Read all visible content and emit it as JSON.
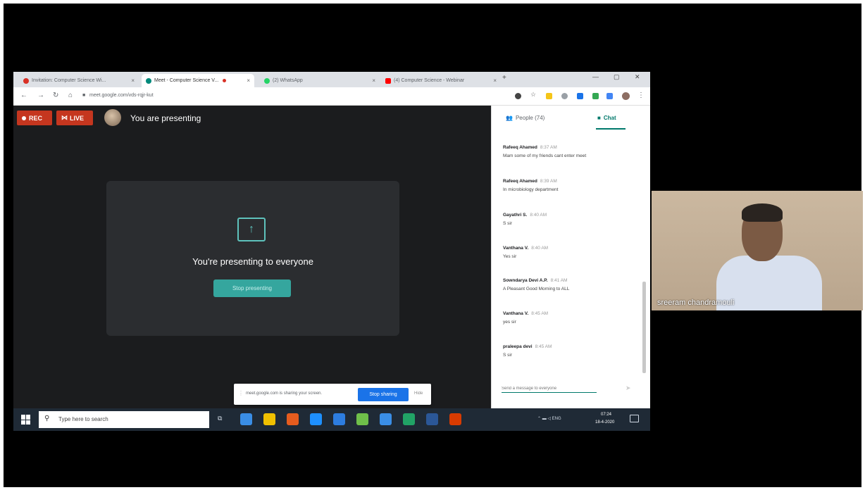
{
  "browser": {
    "tabs": [
      {
        "label": "Invitation: Computer Science Wi...",
        "favicon_color": "#d93025",
        "active": false
      },
      {
        "label": "Meet - Computer Science V...",
        "favicon_color": "#00897b",
        "active": true
      },
      {
        "label": "(2) WhatsApp",
        "favicon_color": "#25d366",
        "active": false
      },
      {
        "label": "(4) Computer Science - Webinar",
        "favicon_color": "#ff0000",
        "active": false
      }
    ],
    "new_tab": "+",
    "url": "meet.google.com/vds-rqjr-kut"
  },
  "meet": {
    "rec_label": "REC",
    "live_label": "LIVE",
    "presenting_label": "You are presenting",
    "present_icon": "↑",
    "presenting_to_everyone": "You're presenting to everyone",
    "stop_presenting": "Stop presenting"
  },
  "share_banner": {
    "text": "meet.google.com is sharing your screen.",
    "stop_sharing": "Stop sharing",
    "hide": "Hide"
  },
  "panel": {
    "people_tab": "People (74)",
    "chat_tab": "Chat",
    "messages": [
      {
        "sender": "Rafeeq Ahamed",
        "time": "8:37 AM",
        "text": "Mam some of my friends cant enter meet"
      },
      {
        "sender": "Rafeeq Ahamed",
        "time": "8:39 AM",
        "text": "In microbiology department"
      },
      {
        "sender": "Gayathri S.",
        "time": "8:40 AM",
        "text": "S sir"
      },
      {
        "sender": "Vanthana V.",
        "time": "8:40 AM",
        "text": "Yes sir"
      },
      {
        "sender": "Sowndarya Devi A.P.",
        "time": "8:41 AM",
        "text": "A Pleasant Good Morning to ALL"
      },
      {
        "sender": "Vanthana V.",
        "time": "8:45 AM",
        "text": "yes sir"
      },
      {
        "sender": "praleepa devi",
        "time": "8:45 AM",
        "text": "S sir"
      }
    ],
    "input_placeholder": "Send a message to everyone",
    "send_icon": "➤"
  },
  "taskbar": {
    "search_placeholder": "Type here to search",
    "app_colors": [
      "#3a8ee6",
      "#f0c000",
      "#e65c1e",
      "#1e90ff",
      "#2d7de0",
      "#6fbf4a",
      "#3a8ee6",
      "#21a366",
      "#2b5797",
      "#d83b01"
    ],
    "tray": "⌃ ▬ ◁ ENG",
    "time": "07:24",
    "date": "18-4-2020"
  },
  "webcam": {
    "name": "sreeram chandramouli"
  },
  "colors": {
    "rec_red": "#c5361f",
    "meet_teal": "#35a69e",
    "chat_accent": "#00796b",
    "share_blue": "#1a73e8"
  }
}
